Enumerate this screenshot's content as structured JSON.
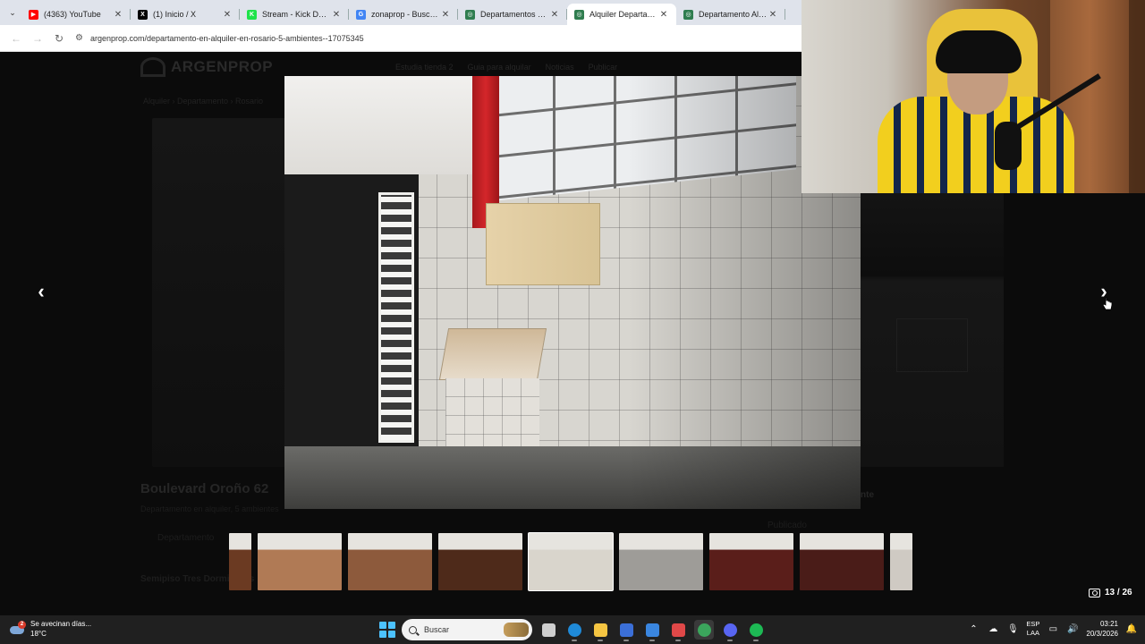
{
  "browser": {
    "tabs": [
      {
        "title": "(4363) YouTube",
        "fav_color": "#ff0000",
        "fav_glyph": "▶",
        "active": false
      },
      {
        "title": "(1) Inicio / X",
        "fav_color": "#000000",
        "fav_glyph": "X",
        "active": false
      },
      {
        "title": "Stream - Kick Dashboard",
        "fav_color": "#1ee34a",
        "fav_glyph": "K",
        "active": false
      },
      {
        "title": "zonaprop - Buscar con Google",
        "fav_color": "#4285f4",
        "fav_glyph": "G",
        "active": false
      },
      {
        "title": "Departamentos en Alquiler",
        "fav_color": "#2f7d4f",
        "fav_glyph": "◎",
        "active": false
      },
      {
        "title": "Alquiler Departamento",
        "fav_color": "#2f7d4f",
        "fav_glyph": "◎",
        "active": true
      },
      {
        "title": "Departamento Alquiler",
        "fav_color": "#2f7d4f",
        "fav_glyph": "◎",
        "active": false
      }
    ],
    "url": "argenprop.com/departamento-en-alquiler-en-rosario-5-ambientes--17075345"
  },
  "background_page": {
    "logo": "ARGENPROP",
    "menu": [
      "Estudia tienda 2",
      "Guia para alquilar",
      "Noticias",
      "Publicar"
    ],
    "breadcrumb": "Alquiler › Departamento › Rosario",
    "title": "Boulevard Oroño 62",
    "subtitle": "Departamento en alquiler, 5 ambientes",
    "type_label": "Departamento",
    "feature_label": "Semipiso Tres Dormitorios",
    "right_label": "nte",
    "right_sub": "Publicado"
  },
  "gallery": {
    "counter_current": "13",
    "counter_total": "26",
    "counter_text": "13 / 26",
    "prev_icon": "‹",
    "next_icon": "›",
    "thumbnails": [
      {
        "tone": "#6b3a22",
        "partial": true,
        "active": false
      },
      {
        "tone": "#b07a55",
        "partial": false,
        "active": false
      },
      {
        "tone": "#8d5a3c",
        "partial": false,
        "active": false
      },
      {
        "tone": "#4e2a1a",
        "partial": false,
        "active": false
      },
      {
        "tone": "#d9d5cc",
        "partial": false,
        "active": true
      },
      {
        "tone": "#9e9c98",
        "partial": false,
        "active": false
      },
      {
        "tone": "#5a1e1a",
        "partial": false,
        "active": false
      },
      {
        "tone": "#4a1c18",
        "partial": false,
        "active": false
      },
      {
        "tone": "#cfcac3",
        "partial": true,
        "active": false
      }
    ]
  },
  "taskbar": {
    "weather_text": "Se avecinan días...",
    "weather_temp": "18°C",
    "weather_badge": "2",
    "search_placeholder": "Buscar",
    "apps": [
      {
        "name": "task-view",
        "color": "#cfcfcf"
      },
      {
        "name": "edge",
        "color": "#1f8ad8"
      },
      {
        "name": "file-explorer",
        "color": "#f5c542"
      },
      {
        "name": "store",
        "color": "#3b6fd8"
      },
      {
        "name": "mail",
        "color": "#3a86e0"
      },
      {
        "name": "snipping",
        "color": "#e04848"
      },
      {
        "name": "chrome",
        "color": "#3ba55c"
      },
      {
        "name": "discord",
        "color": "#5865f2"
      },
      {
        "name": "spotify",
        "color": "#1db954"
      }
    ],
    "lang_top": "ESP",
    "lang_bottom": "LAA",
    "time": "03:21",
    "date": "20/3/2026"
  }
}
